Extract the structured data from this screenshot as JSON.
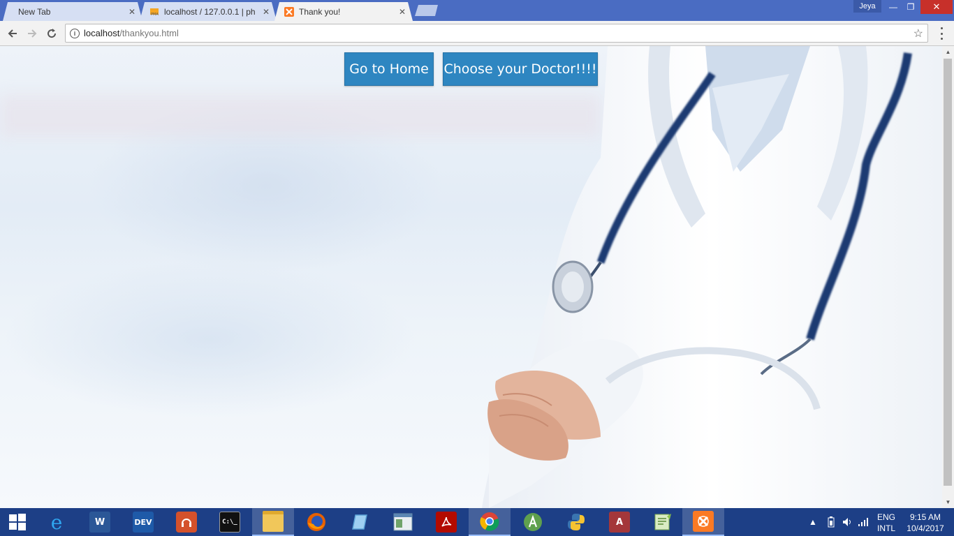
{
  "browser": {
    "tabs": [
      {
        "label": "New Tab",
        "active": false
      },
      {
        "label": "localhost / 127.0.0.1 | ph",
        "active": false
      },
      {
        "label": "Thank you!",
        "active": true
      }
    ],
    "user": "Jeya",
    "address": {
      "host": "localhost",
      "path": "/thankyou.html"
    },
    "icons": {
      "back": "arrow-left-icon",
      "forward": "arrow-right-icon",
      "reload": "reload-icon",
      "info": "info-icon",
      "bookmark": "star-icon",
      "menu": "more-vert-icon"
    }
  },
  "page": {
    "buttons": {
      "home": "Go to Home",
      "doctor": "Choose your Doctor!!!!"
    },
    "button_color": "#2e86c1",
    "background": "blurred hospital with doctor in white coat and stethoscope"
  },
  "taskbar": {
    "apps": [
      {
        "name": "start",
        "icon": "windows-logo-icon"
      },
      {
        "name": "internet-explorer",
        "icon": "ie-icon"
      },
      {
        "name": "word",
        "icon": "word-icon",
        "text": "W"
      },
      {
        "name": "dev-cpp",
        "icon": "devcpp-icon",
        "text": "DEV"
      },
      {
        "name": "audio",
        "icon": "headphones-icon"
      },
      {
        "name": "cmd",
        "icon": "cmd-icon",
        "text": "C:\\_"
      },
      {
        "name": "file-explorer",
        "icon": "folder-icon",
        "active": true
      },
      {
        "name": "firefox",
        "icon": "firefox-icon"
      },
      {
        "name": "notepad",
        "icon": "notepad-icon"
      },
      {
        "name": "app-window",
        "icon": "window-icon"
      },
      {
        "name": "acrobat",
        "icon": "acrobat-icon"
      },
      {
        "name": "chrome",
        "icon": "chrome-icon",
        "active": true
      },
      {
        "name": "android-studio",
        "icon": "android-studio-icon"
      },
      {
        "name": "python",
        "icon": "python-icon"
      },
      {
        "name": "access",
        "icon": "access-icon",
        "text": "A"
      },
      {
        "name": "notepad-plus",
        "icon": "notepadpp-icon"
      },
      {
        "name": "xampp",
        "icon": "xampp-icon",
        "active": true
      }
    ],
    "tray": {
      "lang_line1": "ENG",
      "lang_line2": "INTL",
      "time": "9:15 AM",
      "date": "10/4/2017"
    }
  }
}
